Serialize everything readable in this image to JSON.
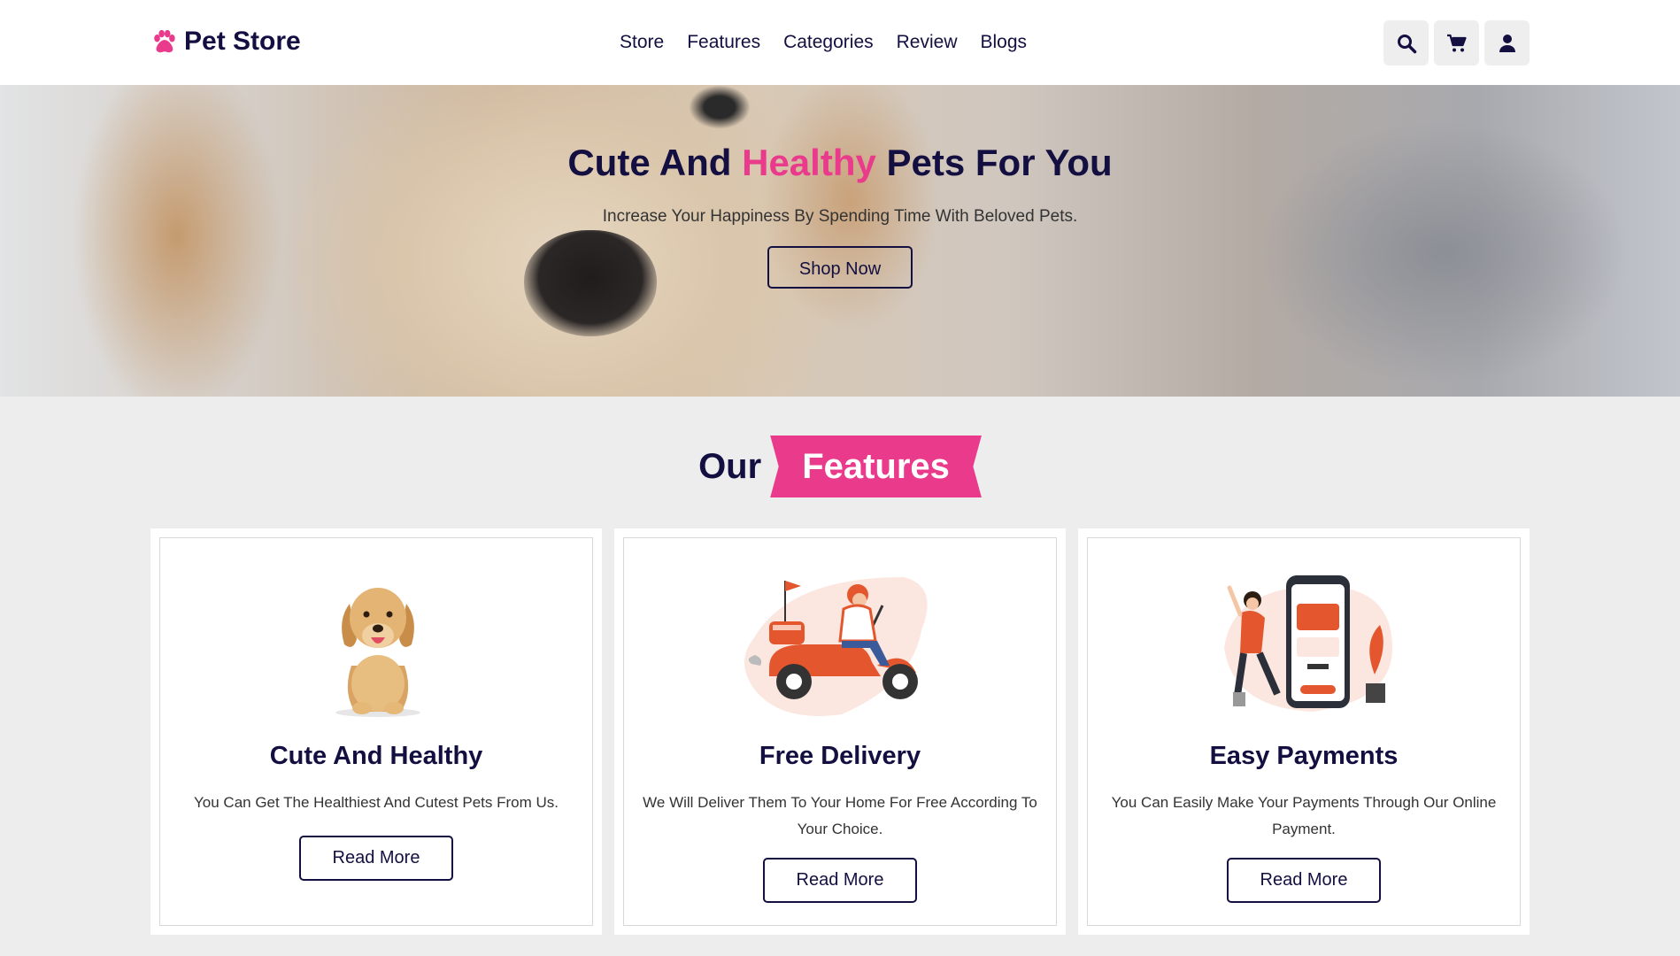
{
  "header": {
    "logo_text": "Pet Store",
    "nav": [
      "Store",
      "Features",
      "Categories",
      "Review",
      "Blogs"
    ],
    "icons": [
      "search-icon",
      "cart-icon",
      "user-icon"
    ]
  },
  "hero": {
    "title_part1": "Cute And ",
    "title_accent": "Healthy",
    "title_part2": " Pets For You",
    "subtitle": "Increase Your Happiness By Spending Time With Beloved Pets.",
    "button": "Shop Now"
  },
  "features": {
    "heading_plain": "Our",
    "heading_highlight": "Features",
    "cards": [
      {
        "title": "Cute And Healthy",
        "description": "You Can Get The Healthiest And Cutest Pets From Us.",
        "button": "Read More",
        "image": "puppy-illustration"
      },
      {
        "title": "Free Delivery",
        "description": "We Will Deliver Them To Your Home For Free According To Your Choice.",
        "button": "Read More",
        "image": "delivery-scooter-illustration"
      },
      {
        "title": "Easy Payments",
        "description": "You Can Easily Make Your Payments Through Our Online Payment.",
        "button": "Read More",
        "image": "mobile-payment-illustration"
      }
    ]
  },
  "colors": {
    "primary": "#130f40",
    "accent": "#e93a8b",
    "page_bg": "#ededed"
  }
}
